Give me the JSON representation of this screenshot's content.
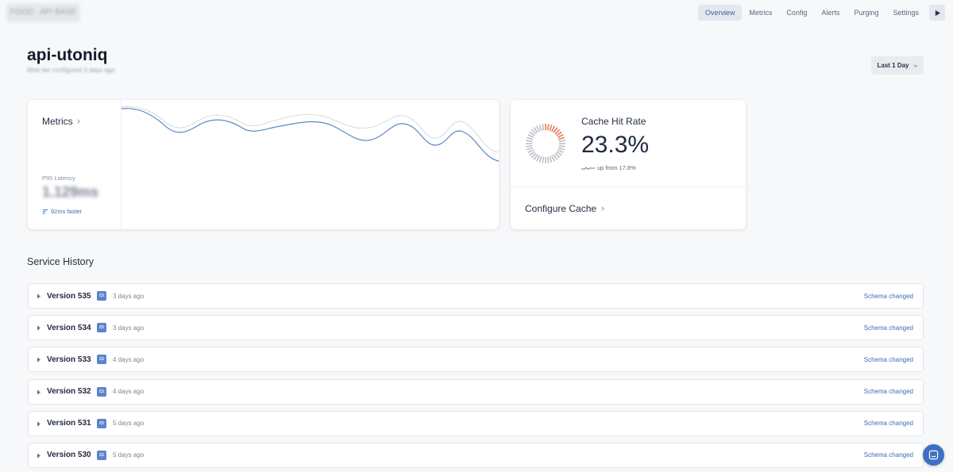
{
  "app": {
    "breadcrumb": "FOOD · API BASE",
    "title": "api-utoniq",
    "subtitle": "Web tier configured 3 days ago"
  },
  "nav": {
    "tabs": [
      {
        "label": "Overview",
        "active": true
      },
      {
        "label": "Metrics",
        "active": false
      },
      {
        "label": "Config",
        "active": false
      },
      {
        "label": "Alerts",
        "active": false
      },
      {
        "label": "Purging",
        "active": false
      },
      {
        "label": "Settings",
        "active": false
      }
    ],
    "play_icon": "play-icon"
  },
  "range": {
    "label": "Last 1 Day",
    "icon": "chevron-down-icon"
  },
  "metrics_card": {
    "title": "Metrics",
    "p95_label": "P95 Latency",
    "p95_value": "1.129ms",
    "faster_text": "92ms faster",
    "line_color": "#5b86c8",
    "ghost_color": "#c7ccd3"
  },
  "cache_card": {
    "title": "Cache Hit Rate",
    "value": "23.3%",
    "trend_text": "up from 17.8%",
    "hit_fraction": 0.233,
    "hit_color": "#e8795a",
    "miss_color": "#b9bfc7",
    "configure_label": "Configure Cache"
  },
  "history": {
    "title": "Service History",
    "rows": [
      {
        "version": "Version 535",
        "badge": "CI",
        "ago": "3 days ago",
        "status": "Schema changed"
      },
      {
        "version": "Version 534",
        "badge": "CI",
        "ago": "3 days ago",
        "status": "Schema changed"
      },
      {
        "version": "Version 533",
        "badge": "CI",
        "ago": "4 days ago",
        "status": "Schema changed"
      },
      {
        "version": "Version 532",
        "badge": "CI",
        "ago": "4 days ago",
        "status": "Schema changed"
      },
      {
        "version": "Version 531",
        "badge": "CI",
        "ago": "5 days ago",
        "status": "Schema changed"
      },
      {
        "version": "Version 530",
        "badge": "CI",
        "ago": "5 days ago",
        "status": "Schema changed"
      }
    ]
  },
  "chat": {
    "icon": "chat-icon"
  }
}
